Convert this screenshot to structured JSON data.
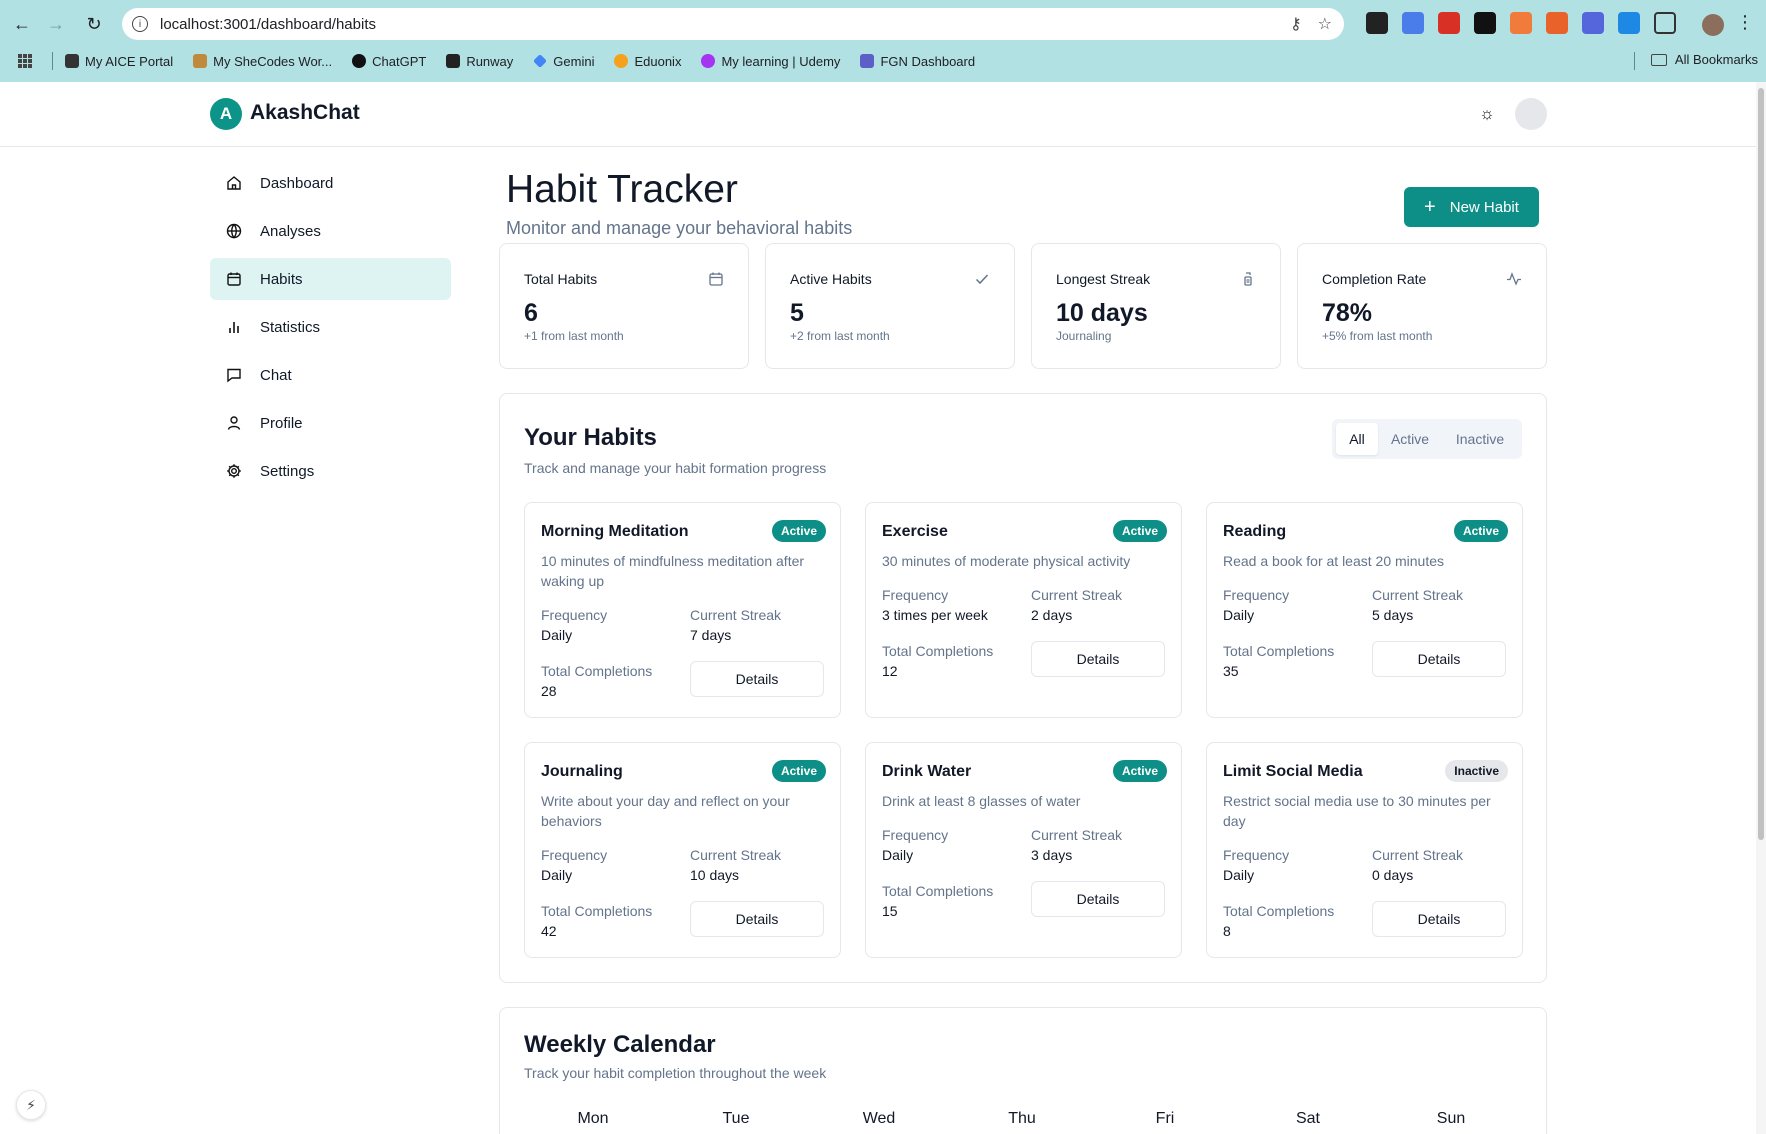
{
  "browser": {
    "url": "localhost:3001/dashboard/habits",
    "bookmarks": [
      {
        "label": "My AICE Portal",
        "color": "#333333"
      },
      {
        "label": "My SheCodes Wor...",
        "color": "#c08a3e"
      },
      {
        "label": "ChatGPT",
        "color": "#111111"
      },
      {
        "label": "Runway",
        "color": "#222222"
      },
      {
        "label": "Gemini",
        "color": "#4285f4"
      },
      {
        "label": "Eduonix",
        "color": "#f4a21c"
      },
      {
        "label": "My learning | Udemy",
        "color": "#a435f0"
      },
      {
        "label": "FGN Dashboard",
        "color": "#5b5fc7"
      }
    ],
    "all_bookmarks": "All Bookmarks"
  },
  "app": {
    "logo_letter": "A",
    "name": "AkashChat"
  },
  "sidebar": {
    "items": [
      {
        "label": "Dashboard",
        "icon": "home-icon"
      },
      {
        "label": "Analyses",
        "icon": "globe-icon"
      },
      {
        "label": "Habits",
        "icon": "calendar-icon"
      },
      {
        "label": "Statistics",
        "icon": "bar-chart-icon"
      },
      {
        "label": "Chat",
        "icon": "message-icon"
      },
      {
        "label": "Profile",
        "icon": "user-icon"
      },
      {
        "label": "Settings",
        "icon": "gear-icon"
      }
    ],
    "active": "Habits"
  },
  "page": {
    "title": "Habit Tracker",
    "subtitle": "Monitor and manage your behavioral habits",
    "new_habit_label": "New Habit"
  },
  "stats": [
    {
      "label": "Total Habits",
      "value": "6",
      "sub": "+1 from last month",
      "icon": "calendar-icon"
    },
    {
      "label": "Active Habits",
      "value": "5",
      "sub": "+2 from last month",
      "icon": "check-icon"
    },
    {
      "label": "Longest Streak",
      "value": "10 days",
      "sub": "Journaling",
      "icon": "trophy-icon"
    },
    {
      "label": "Completion Rate",
      "value": "78%",
      "sub": "+5% from last month",
      "icon": "activity-icon"
    }
  ],
  "habits_section": {
    "title": "Your Habits",
    "subtitle": "Track and manage your habit formation progress",
    "tabs": [
      "All",
      "Active",
      "Inactive"
    ],
    "active_tab": "All",
    "labels": {
      "frequency": "Frequency",
      "current_streak": "Current Streak",
      "total_completions": "Total Completions",
      "details": "Details"
    },
    "habits": [
      {
        "name": "Morning Meditation",
        "status": "Active",
        "description": "10 minutes of mindfulness meditation after waking up",
        "frequency": "Daily",
        "streak": "7 days",
        "completions": "28"
      },
      {
        "name": "Exercise",
        "status": "Active",
        "description": "30 minutes of moderate physical activity",
        "frequency": "3 times per week",
        "streak": "2 days",
        "completions": "12"
      },
      {
        "name": "Reading",
        "status": "Active",
        "description": "Read a book for at least 20 minutes",
        "frequency": "Daily",
        "streak": "5 days",
        "completions": "35"
      },
      {
        "name": "Journaling",
        "status": "Active",
        "description": "Write about your day and reflect on your behaviors",
        "frequency": "Daily",
        "streak": "10 days",
        "completions": "42"
      },
      {
        "name": "Drink Water",
        "status": "Active",
        "description": "Drink at least 8 glasses of water",
        "frequency": "Daily",
        "streak": "3 days",
        "completions": "15"
      },
      {
        "name": "Limit Social Media",
        "status": "Inactive",
        "description": "Restrict social media use to 30 minutes per day",
        "frequency": "Daily",
        "streak": "0 days",
        "completions": "8"
      }
    ]
  },
  "calendar": {
    "title": "Weekly Calendar",
    "subtitle": "Track your habit completion throughout the week",
    "days": [
      "Mon",
      "Tue",
      "Wed",
      "Thu",
      "Fri",
      "Sat",
      "Sun"
    ]
  }
}
